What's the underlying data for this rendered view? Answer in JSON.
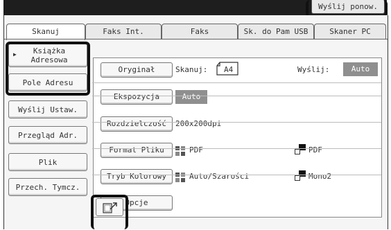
{
  "header": {
    "resend_label": "Wyślij ponow."
  },
  "tabs": [
    {
      "label": "Skanuj",
      "active": true
    },
    {
      "label": "Faks Int.",
      "active": false
    },
    {
      "label": "Faks",
      "active": false
    },
    {
      "label": "Sk. do Pam USB",
      "active": false
    },
    {
      "label": "Skaner PC",
      "active": false
    }
  ],
  "sidebar": {
    "address_book_line1": "Książka",
    "address_book_line2": "Adresowa",
    "address_entry": "Pole Adresu",
    "send_settings": "Wyślij Ustaw.",
    "address_review": "Przegląd Adr.",
    "file": "Plik",
    "quick_file": "Przech. Tymcz."
  },
  "settings": {
    "original": {
      "button": "Oryginał",
      "scan_label": "Skanuj:",
      "scan_value": "A4",
      "send_label": "Wyślij:",
      "send_value": "Auto"
    },
    "exposure": {
      "button": "Ekspozycja",
      "value": "Auto"
    },
    "resolution": {
      "button": "Rozdzielczość",
      "value": "200x200dpi"
    },
    "file_format": {
      "button": "Format Pliku",
      "color_value": "PDF",
      "mono_value": "PDF"
    },
    "color_mode": {
      "button": "Tryb Kolorowy",
      "color_value": "Auto/Szarości",
      "mono_value": "Mono2"
    },
    "options": {
      "button": "Opcje"
    }
  },
  "colors": {
    "highlight": "#111111",
    "auto_box": "#8f8f8f",
    "top_bar": "#1e1e1e"
  }
}
